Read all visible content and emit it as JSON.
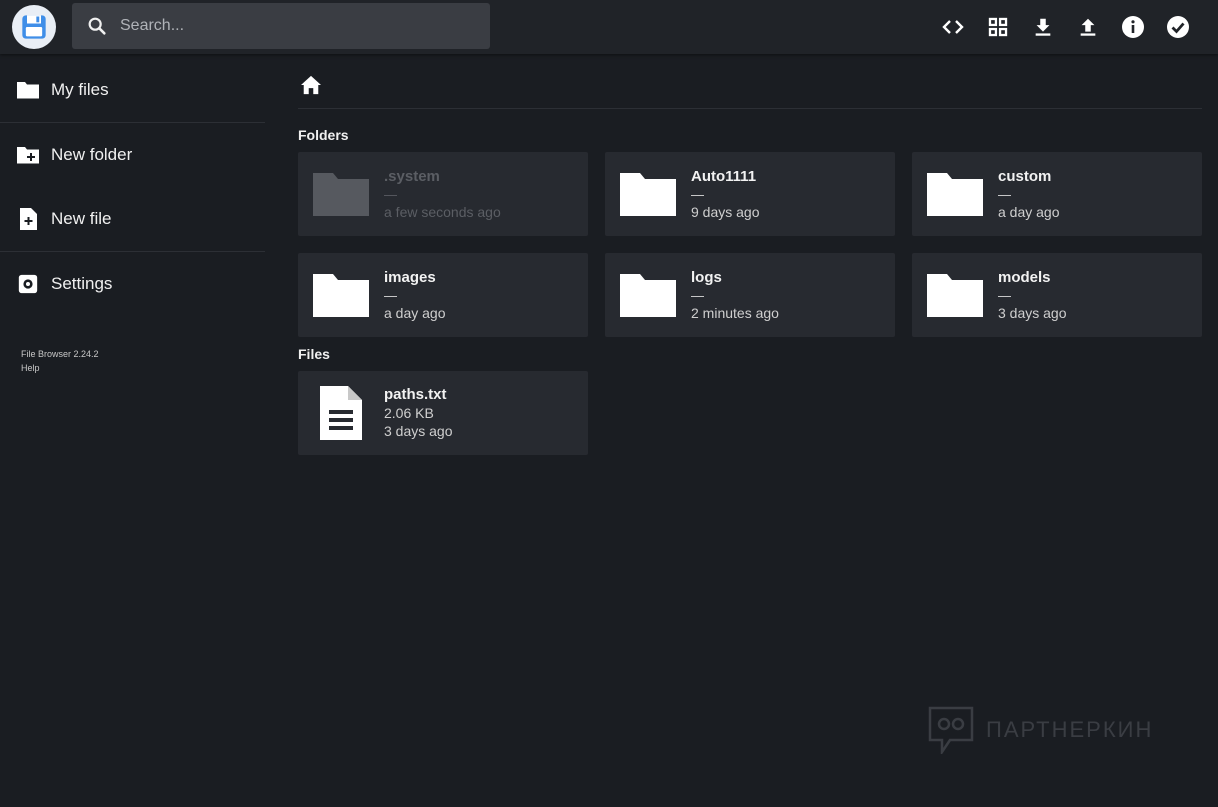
{
  "search": {
    "placeholder": "Search..."
  },
  "header_actions": [
    {
      "icon": "code-icon"
    },
    {
      "icon": "grid-view-icon"
    },
    {
      "icon": "download-icon"
    },
    {
      "icon": "upload-icon"
    },
    {
      "icon": "info-icon"
    },
    {
      "icon": "check-circle-icon"
    }
  ],
  "sidebar": {
    "items": [
      {
        "label": "My files",
        "icon": "folder-icon"
      },
      {
        "label": "New folder",
        "icon": "new-folder-icon"
      },
      {
        "label": "New file",
        "icon": "new-file-icon"
      },
      {
        "label": "Settings",
        "icon": "settings-icon"
      }
    ],
    "version": "File Browser 2.24.2",
    "help": "Help"
  },
  "breadcrumb": {
    "home_icon": "home-icon"
  },
  "sections": {
    "folders": "Folders",
    "files": "Files"
  },
  "folders": [
    {
      "name": ".system",
      "size": "—",
      "modified": "a few seconds ago",
      "dimmed": true
    },
    {
      "name": "Auto1111",
      "size": "—",
      "modified": "9 days ago"
    },
    {
      "name": "custom",
      "size": "—",
      "modified": "a day ago"
    },
    {
      "name": "images",
      "size": "—",
      "modified": "a day ago"
    },
    {
      "name": "logs",
      "size": "—",
      "modified": "2 minutes ago"
    },
    {
      "name": "models",
      "size": "—",
      "modified": "3 days ago"
    }
  ],
  "files": [
    {
      "name": "paths.txt",
      "size": "2.06 KB",
      "modified": "3 days ago"
    }
  ],
  "watermark": "ПАРТНЕРКИН",
  "colors": {
    "background": "#1a1d22",
    "card": "#272a30",
    "header": "#202328"
  }
}
